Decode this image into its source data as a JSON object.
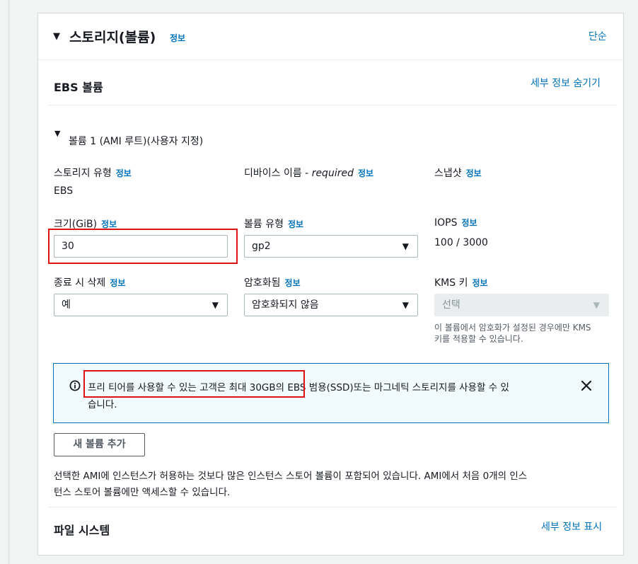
{
  "storage": {
    "title": "스토리지(볼륨)",
    "info": "정보",
    "simple_link": "단순"
  },
  "ebs": {
    "title": "EBS 볼륨",
    "hide_details": "세부 정보 숨기기"
  },
  "volume": {
    "header": "볼륨 1 (AMI 루트)(사용자 지정)",
    "storage_type_label": "스토리지 유형",
    "storage_type_value": "EBS",
    "device_name_label": "디바이스 이름 - ",
    "device_name_required": "required",
    "snapshot_label": "스냅샷",
    "size_label": "크기(GiB)",
    "size_value": "30",
    "volume_type_label": "볼륨 유형",
    "volume_type_value": "gp2",
    "iops_label": "IOPS",
    "iops_value": "100 / 3000",
    "delete_on_term_label": "종료 시 삭제",
    "delete_on_term_value": "예",
    "encrypted_label": "암호화됨",
    "encrypted_value": "암호화되지 않음",
    "kms_label": "KMS 키",
    "kms_placeholder": "선택",
    "kms_help_line1": "이 볼륨에서 암호화가 설정된 경우에만 KMS",
    "kms_help_line2": "키를 적용할 수 있습니다."
  },
  "alert": {
    "text_line1": "프리 티어를 사용할 수 있는 고객은 최대 30GB의 EBS 범용(SSD)또는 마그네틱 스토리지를 사용할 수 있",
    "text_line2": "습니다."
  },
  "add_volume_button": "새 볼륨 추가",
  "note": {
    "line1": "선택한 AMI에 인스턴스가 허용하는 것보다 많은 인스턴스 스토어 볼륨이 포함되어 있습니다. AMI에서 처음 0개의 인스",
    "line2": "턴스 스토어 볼륨에만 액세스할 수 있습니다."
  },
  "filesystem": {
    "title": "파일 시스템",
    "show_details": "세부 정보 표시"
  },
  "info_label": "정보",
  "colors": {
    "link": "#0073bb",
    "highlight_box": "#dd1111",
    "alert_border": "#0073bb",
    "alert_bg": "#f1faff"
  },
  "icons": {
    "collapse": "caret-down-icon",
    "info_circle": "info-circle-icon",
    "close": "close-icon",
    "dropdown": "dropdown-caret-icon"
  }
}
